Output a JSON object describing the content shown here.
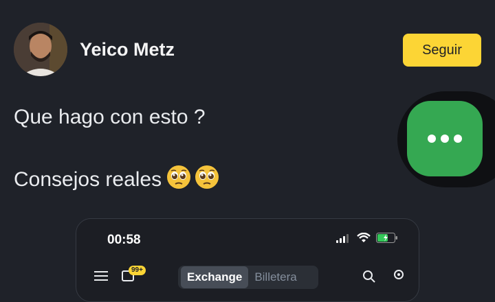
{
  "post": {
    "author": "Yeico Metz",
    "follow_label": "Seguir",
    "text_line1": "Que hago con esto ?",
    "text_line2": "Consejos reales",
    "emoji": "🥺🥺"
  },
  "embedded_screenshot": {
    "time": "00:58",
    "badge": "99+",
    "tabs": [
      {
        "label": "Exchange",
        "active": true
      },
      {
        "label": "Billetera",
        "active": false
      }
    ]
  },
  "colors": {
    "background": "#1f2229",
    "follow_button": "#fcd535",
    "more_button": "#35a852"
  }
}
